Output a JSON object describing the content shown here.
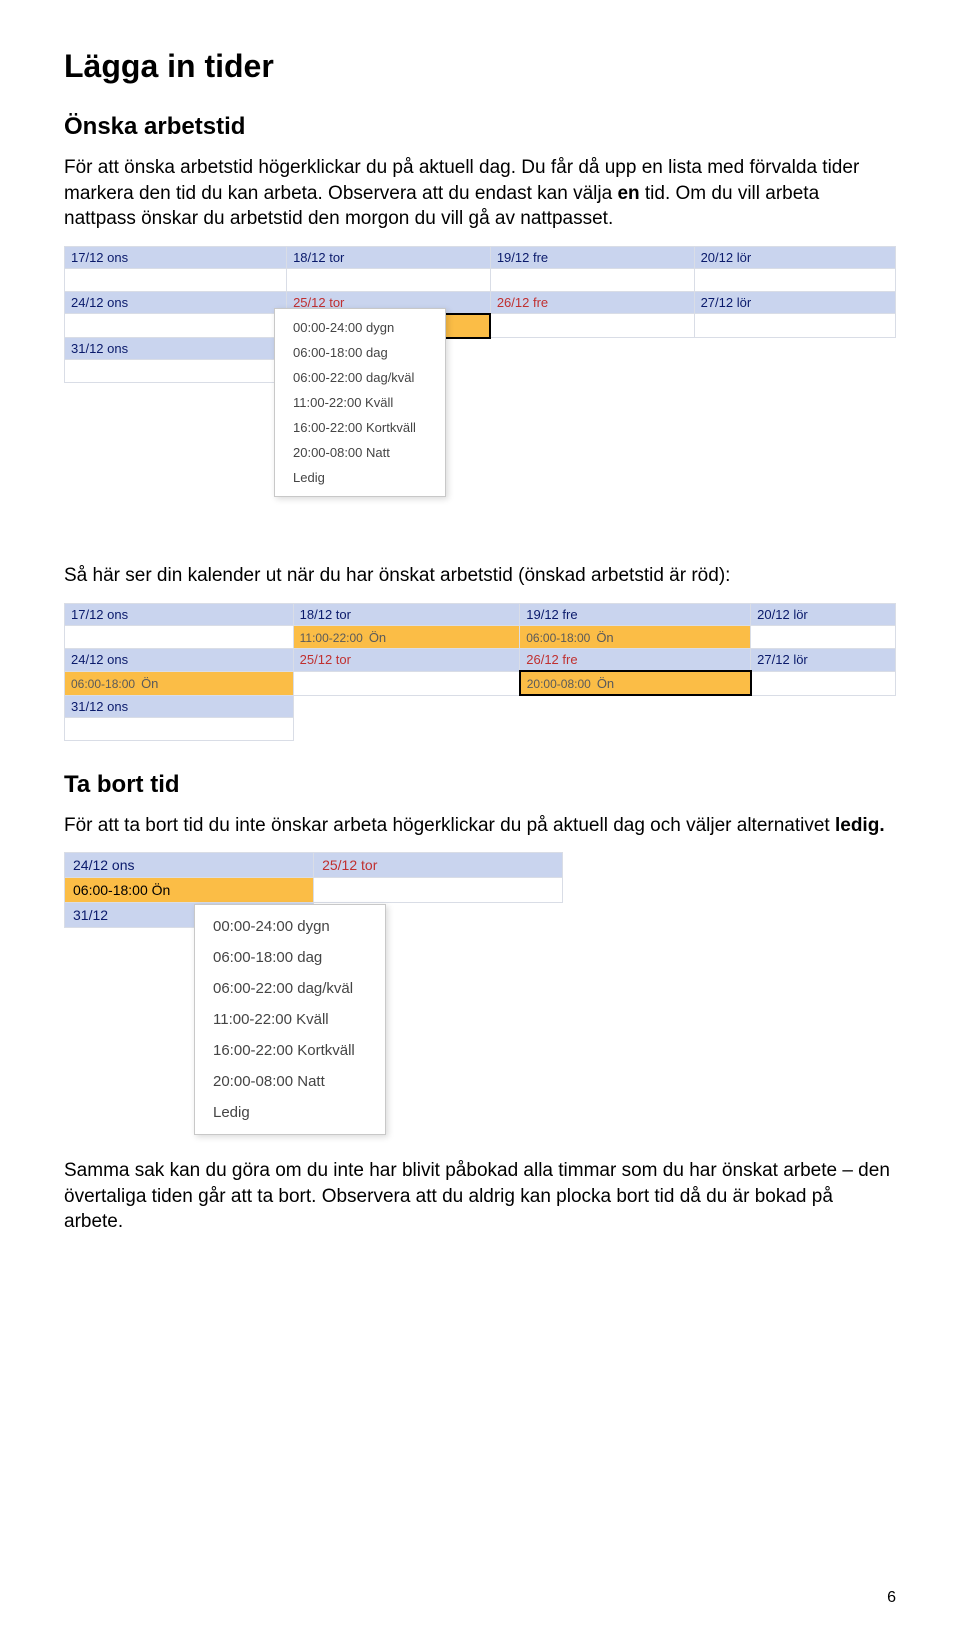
{
  "heading1": "Lägga in tider",
  "section1": {
    "title": "Önska arbetstid",
    "p1a": "För att önska arbetstid högerklickar du på aktuell dag. Du får då upp en lista med förvalda tider markera den tid du kan arbeta. Observera att du endast kan välja ",
    "p1b": "en",
    "p1c": " tid. Om du vill arbeta nattpass önskar du arbetstid den morgon du vill gå av nattpasset."
  },
  "cal1": {
    "rows": [
      [
        "17/12 ons",
        "18/12 tor",
        "19/12 fre",
        "20/12 lör"
      ],
      [
        "24/12 ons",
        "25/12 tor",
        "26/12 fre",
        "27/12 lör"
      ],
      [
        "31/12 ons",
        "",
        "",
        ""
      ]
    ],
    "holiday": [
      "25/12 tor",
      "26/12 fre"
    ],
    "active_cell": "25/12 tor"
  },
  "ctx_items": [
    "00:00-24:00 dygn",
    "06:00-18:00 dag",
    "06:00-22:00 dag/kväl",
    "11:00-22:00 Kväll",
    "16:00-22:00 Kortkväll",
    "20:00-08:00 Natt",
    "Ledig"
  ],
  "section2": {
    "intro": "Så här ser din kalender ut när du har önskat arbetstid (önskad arbetstid är röd):"
  },
  "cal2": {
    "headers": [
      "17/12 ons",
      "18/12 tor",
      "19/12 fre",
      "20/12 lör"
    ],
    "row1": [
      {
        "time": "",
        "label": ""
      },
      {
        "time": "11:00-22:00",
        "label": "Ön"
      },
      {
        "time": "06:00-18:00",
        "label": "Ön"
      },
      {
        "time": "",
        "label": ""
      }
    ],
    "headers2": [
      "24/12 ons",
      "25/12 tor",
      "26/12 fre",
      "27/12 lör"
    ],
    "row2": [
      {
        "time": "06:00-18:00",
        "label": "Ön"
      },
      {
        "time": "",
        "label": ""
      },
      {
        "time": "20:00-08:00",
        "label": "Ön",
        "border": true
      },
      {
        "time": "",
        "label": ""
      }
    ],
    "headers3": [
      "31/12 ons",
      "",
      "",
      ""
    ],
    "holiday": [
      "25/12 tor",
      "26/12 fre"
    ]
  },
  "section3": {
    "title": "Ta bort tid",
    "p1a": "För att ta bort tid du inte önskar arbeta högerklickar du på aktuell dag och väljer alternativet ",
    "p1b": "ledig."
  },
  "cal3": {
    "headers": [
      "24/12 ons",
      "25/12 tor"
    ],
    "row": {
      "time": "06:00-18:00",
      "label": "Ön"
    },
    "next_header": "31/12"
  },
  "section4": {
    "p": "Samma sak kan du göra om du inte har blivit påbokad alla timmar som du har önskat arbete – den övertaliga tiden går att ta bort. Observera att du aldrig kan plocka bort tid då du är bokad på arbete."
  },
  "page_number": "6"
}
